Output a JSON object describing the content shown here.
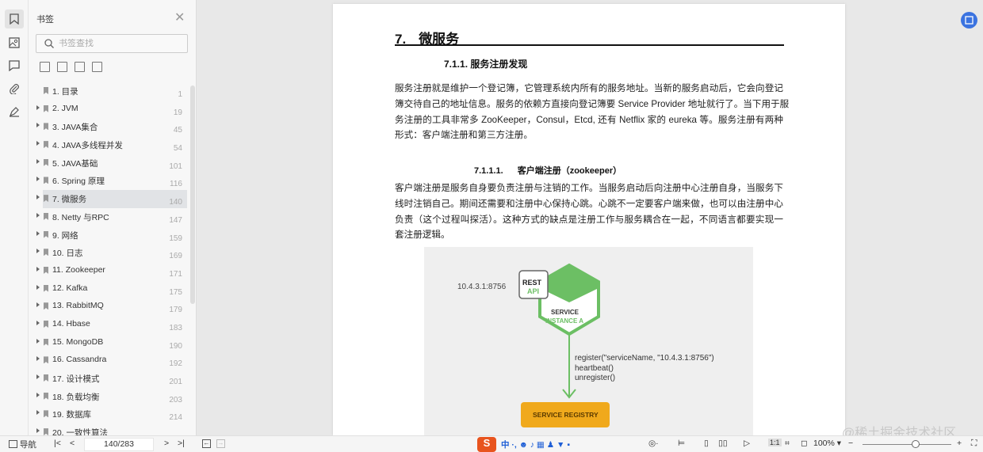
{
  "sidebar": {
    "title": "书签",
    "search_placeholder": "书签查找",
    "items": [
      {
        "label": "1. 目录",
        "page": "1",
        "expandable": false
      },
      {
        "label": "2. JVM",
        "page": "19",
        "expandable": true
      },
      {
        "label": "3. JAVA集合",
        "page": "45",
        "expandable": true
      },
      {
        "label": "4. JAVA多线程并发",
        "page": "54",
        "expandable": true
      },
      {
        "label": "5. JAVA基础",
        "page": "101",
        "expandable": true
      },
      {
        "label": "6. Spring 原理",
        "page": "116",
        "expandable": true
      },
      {
        "label": "7.   微服务",
        "page": "140",
        "expandable": true,
        "selected": true
      },
      {
        "label": "8. Netty 与RPC",
        "page": "147",
        "expandable": true
      },
      {
        "label": "9. 网络",
        "page": "159",
        "expandable": true
      },
      {
        "label": "10. 日志",
        "page": "169",
        "expandable": true
      },
      {
        "label": "11. Zookeeper",
        "page": "171",
        "expandable": true
      },
      {
        "label": "12. Kafka",
        "page": "175",
        "expandable": true
      },
      {
        "label": "13. RabbitMQ",
        "page": "179",
        "expandable": true
      },
      {
        "label": "14. Hbase",
        "page": "183",
        "expandable": true
      },
      {
        "label": "15. MongoDB",
        "page": "190",
        "expandable": true
      },
      {
        "label": "16. Cassandra",
        "page": "192",
        "expandable": true
      },
      {
        "label": "17. 设计模式",
        "page": "201",
        "expandable": true
      },
      {
        "label": "18. 负载均衡",
        "page": "203",
        "expandable": true
      },
      {
        "label": "19. 数据库",
        "page": "214",
        "expandable": true
      },
      {
        "label": "20. 一致性算法",
        "page": "",
        "expandable": true
      }
    ]
  },
  "document": {
    "h1_num": "7.",
    "h1_text": "微服务",
    "h2": "7.1.1.  服务注册发现",
    "p1": [
      " 服务注册就是维护一个登记簿，它管理系统内所有的服务地址。当新的服务启动后，它会向登记",
      "簿交待自己的地址信息。服务的依赖方直接向登记簿要 Service Provider 地址就行了。当下用于服",
      "务注册的工具非常多 ZooKeeper，Consul，Etcd, 还有 Netflix 家的 eureka 等。服务注册有两种",
      "形式：客户端注册和第三方注册。"
    ],
    "h3_num": "7.1.1.1.",
    "h3_text": "客户端注册（zookeeper）",
    "p2": [
      "客户端注册是服务自身要负责注册与注销的工作。当服务启动后向注册中心注册自身，当服务下",
      "线时注销自己。期间还需要和注册中心保持心跳。心跳不一定要客户端来做，也可以由注册中心",
      "负责（这个过程叫探活）。这种方式的缺点是注册工作与服务耦合在一起，不同语言都要实现一",
      "套注册逻辑。"
    ],
    "figure": {
      "address": "10.4.3.1:8756",
      "rest": "REST",
      "api": "API",
      "service": "SERVICE",
      "instance": "INSTANCE A",
      "calls": [
        "register(\"serviceName, \"10.4.3.1:8756\")",
        "heartbeat()",
        "unregister()"
      ],
      "registry": "SERVICE REGISTRY",
      "green": "#6cbf64",
      "orange": "#f0a91c"
    }
  },
  "bottom": {
    "nav_label": "导航",
    "page_indicator": "140/283",
    "zoom": "100%",
    "zoom_fraction": 0.6
  },
  "watermark": "@稀土掘金技术社区"
}
